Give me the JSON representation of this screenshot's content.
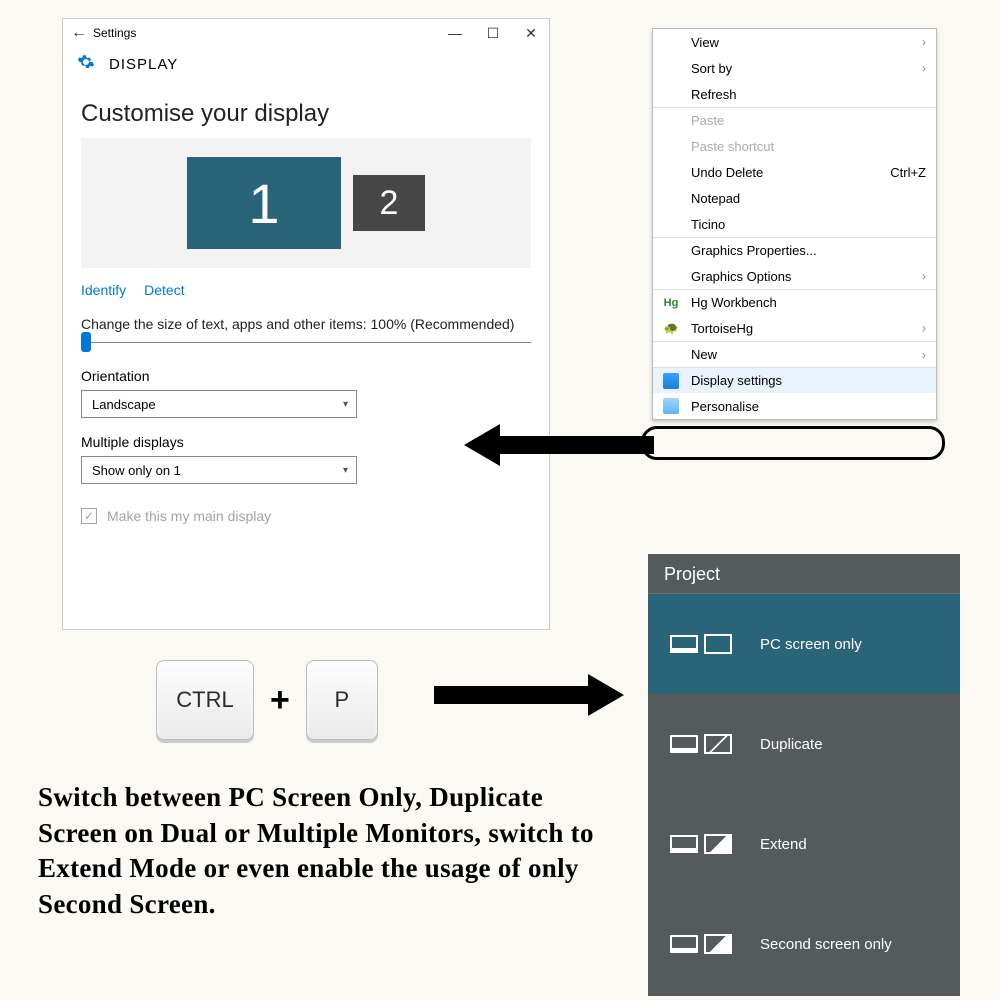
{
  "settings": {
    "app_title": "Settings",
    "header": "DISPLAY",
    "section_title": "Customise your display",
    "monitor1": "1",
    "monitor2": "2",
    "identify": "Identify",
    "detect": "Detect",
    "scale_label": "Change the size of text, apps and other items: 100% (Recommended)",
    "orientation_label": "Orientation",
    "orientation_value": "Landscape",
    "multiple_label": "Multiple displays",
    "multiple_value": "Show only on 1",
    "main_display": "Make this my main display"
  },
  "context_menu": {
    "items": [
      {
        "label": "View",
        "submenu": true
      },
      {
        "label": "Sort by",
        "submenu": true
      },
      {
        "label": "Refresh"
      },
      {
        "label": "Paste",
        "disabled": true,
        "sep": true
      },
      {
        "label": "Paste shortcut",
        "disabled": true
      },
      {
        "label": "Undo Delete",
        "shortcut": "Ctrl+Z"
      },
      {
        "label": "Notepad"
      },
      {
        "label": "Ticino"
      },
      {
        "label": "Graphics Properties...",
        "sep": true
      },
      {
        "label": "Graphics Options",
        "submenu": true
      },
      {
        "label": "Hg Workbench",
        "icon": "hg",
        "sep": true
      },
      {
        "label": "TortoiseHg",
        "submenu": true,
        "icon": "tort"
      },
      {
        "label": "New",
        "submenu": true,
        "sep": true
      },
      {
        "label": "Display settings",
        "icon": "monitor",
        "sep": true,
        "highlight": true
      },
      {
        "label": "Personalise",
        "icon": "desktop"
      }
    ]
  },
  "keys": {
    "ctrl": "CTRL",
    "p": "P"
  },
  "caption": "Switch between PC Screen Only, Duplicate Screen on Dual or Multiple Monitors, switch to Extend Mode or even enable the usage of only Second Screen.",
  "project": {
    "title": "Project",
    "items": [
      {
        "label": "PC screen only",
        "selected": true
      },
      {
        "label": "Duplicate"
      },
      {
        "label": "Extend"
      },
      {
        "label": "Second screen only"
      }
    ]
  }
}
